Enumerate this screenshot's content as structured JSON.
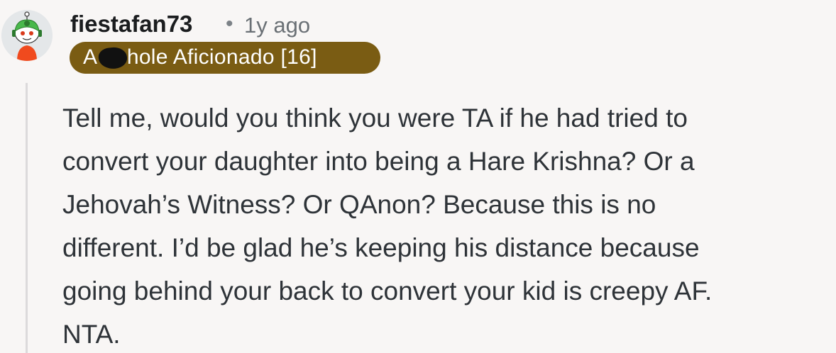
{
  "comment": {
    "username": "fiestafan73",
    "separator": "•",
    "timestamp": "1y ago",
    "flair": "A     hole Aficionado [16]",
    "avatar_icon": "snoo-avatar-icon",
    "body_lines": [
      "Tell me, would you think you were TA if he had tried to",
      "convert your daughter into being a Hare Krishna? Or a",
      "Jehovah’s Witness? Or QAnon? Because this is no",
      "different. I’d be glad he’s keeping his distance because",
      "going behind your back to convert your kid is creepy AF.",
      "NTA."
    ]
  },
  "colors": {
    "background": "#f8f6f5",
    "flair_background": "#7a5c13",
    "body_text": "#2e3338",
    "thread_line": "#dcdadb"
  }
}
